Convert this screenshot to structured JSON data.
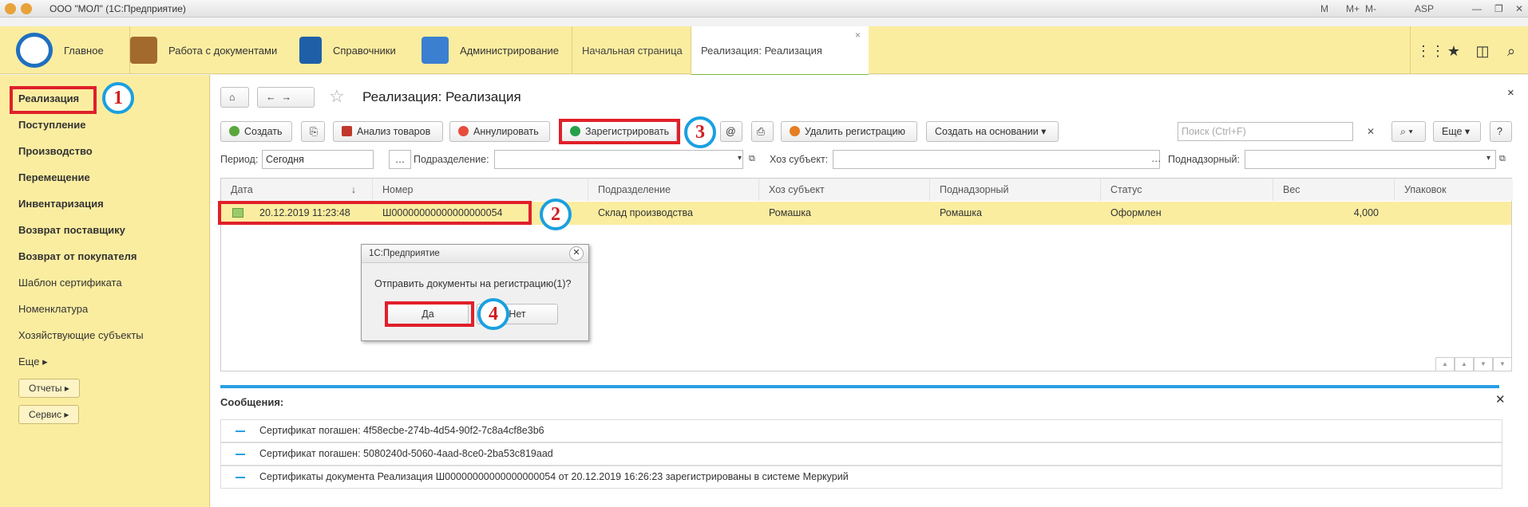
{
  "window": {
    "title": "ООО \"МОЛ\"  (1С:Предприятие)",
    "user": "ASP",
    "right_labels": [
      "M",
      "M+",
      "M-"
    ]
  },
  "sections": [
    {
      "label": "Главное",
      "icon": "logo-icon"
    },
    {
      "label": "Работа с документами",
      "icon": "briefcase-icon"
    },
    {
      "label": "Справочники",
      "icon": "book-icon"
    },
    {
      "label": "Администрирование",
      "icon": "tools-icon"
    }
  ],
  "tabs": [
    {
      "label": "Начальная страница"
    },
    {
      "label": "Реализация: Реализация",
      "close": "×"
    }
  ],
  "nav": {
    "items": [
      "Реализация",
      "Поступление",
      "Производство",
      "Перемещение",
      "Инвентаризация",
      "Возврат поставщику",
      "Возврат от покупателя",
      "Шаблон сертификата",
      "Номенклатура",
      "Хозяйствующие субъекты",
      "Еще"
    ],
    "buttons": [
      "Отчеты",
      "Сервис"
    ]
  },
  "form": {
    "title": "Реализация: Реализация",
    "close": "×",
    "toolbar": {
      "create": "Создать",
      "analysis": "Анализ товаров",
      "cancel": "Аннулировать",
      "register": "Зарегистрировать",
      "at": "@",
      "delete_reg": "Удалить регистрацию",
      "create_based": "Создать на основании",
      "search_placeholder": "Поиск (Ctrl+F)",
      "more": "Еще",
      "help": "?"
    },
    "filters": {
      "period_label": "Период:",
      "period_value": "Сегодня",
      "division_label": "Подразделение:",
      "subject_label": "Хоз субъект:",
      "supervised_label": "Поднадзорный:"
    }
  },
  "table": {
    "columns": [
      "Дата",
      "Номер",
      "Подразделение",
      "Хоз субъект",
      "Поднадзорный",
      "Статус",
      "Вес",
      "Упаковок"
    ],
    "rows": [
      {
        "date": "20.12.2019 11:23:48",
        "number": "Ш00000000000000000054",
        "division": "Склад производства",
        "subject": "Ромашка",
        "supervised": "Ромашка",
        "status": "Оформлен",
        "weight": "4,000",
        "packages": ""
      }
    ]
  },
  "dialog": {
    "title": "1С:Предприятие",
    "text": "Отправить документы на регистрацию(1)?",
    "yes": "Да",
    "no": "Нет"
  },
  "messages": {
    "title": "Сообщения:",
    "items": [
      "Сертификат погашен: 4f58ecbe-274b-4d54-90f2-7c8a4cf8e3b6",
      "Сертификат погашен: 5080240d-5060-4aad-8ce0-2ba53c819aad",
      "Сертификаты документа Реализация Ш00000000000000000054 от 20.12.2019 16:26:23 зарегистрированы в системе Меркурий"
    ]
  },
  "annotations": [
    "1",
    "2",
    "3",
    "4"
  ],
  "colors": {
    "section_bar": "#fbeda0",
    "highlight_row": "#fbeda0",
    "annotation_red": "#e0202a",
    "annotation_blue": "#1aa0e0"
  }
}
